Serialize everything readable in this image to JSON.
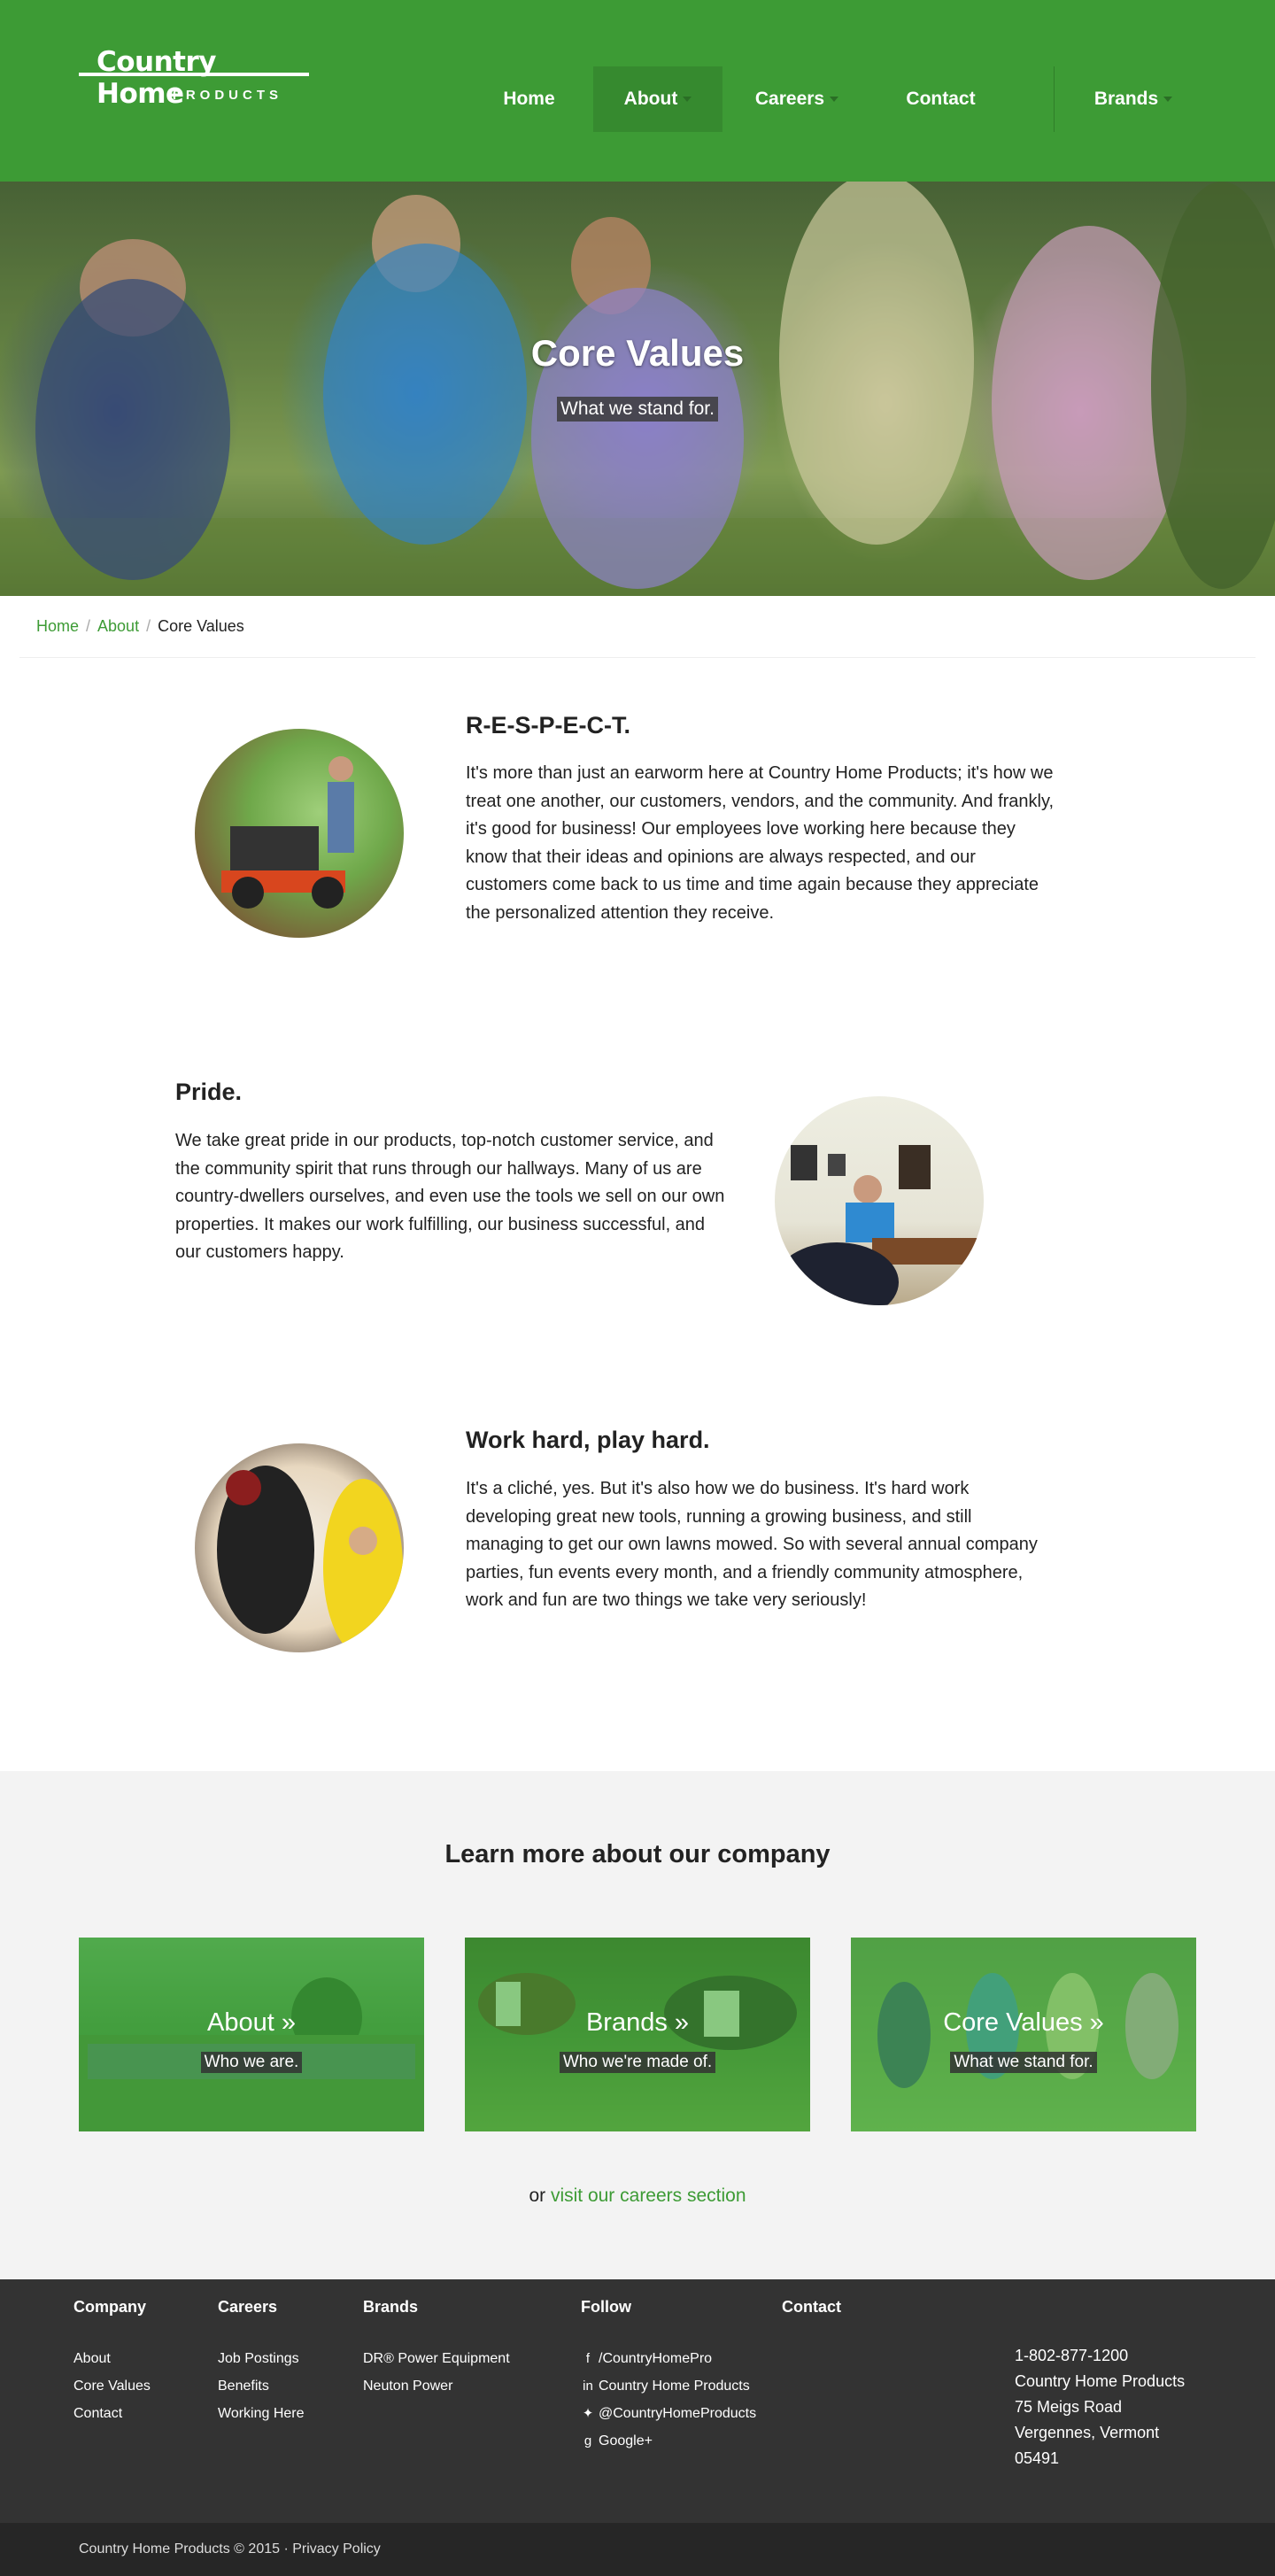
{
  "brand": {
    "name": "Country Home",
    "sub": "PRODUCTS"
  },
  "nav": [
    {
      "label": "Home"
    },
    {
      "label": "About"
    },
    {
      "label": "Careers"
    },
    {
      "label": "Contact"
    },
    {
      "label": "Brands"
    }
  ],
  "hero": {
    "title": "Core Values",
    "subtitle": "What we stand for."
  },
  "breadcrumb": {
    "home": "Home",
    "about": "About",
    "current": "Core Values",
    "sep": "/"
  },
  "values": [
    {
      "title": "R-E-S-P-E-C-T.",
      "text": "It's more than just an earworm here at Country Home Products; it's how we treat one another, our customers, vendors, and the community. And frankly, it's good for business! Our employees love working here because they know that their ideas and opinions are always respected, and our customers come back to us time and time again because they appreciate the personalized attention they receive."
    },
    {
      "title": "Pride.",
      "text": "We take great pride in our products, top-notch customer service, and the community spirit that runs through our hallways. Many of us are country-dwellers ourselves, and even use the tools we sell on our own properties. It makes our work fulfilling, our business successful, and our customers happy."
    },
    {
      "title": "Work hard, play hard.",
      "text": "It's a cliché, yes. But it's also how we do business. It's hard work developing great new tools, running a growing business, and still managing to get our own lawns mowed. So with several annual company parties, fun events every month, and a friendly community atmosphere, work and fun are two things we take very seriously!"
    }
  ],
  "learn": {
    "title_bold": "Learn more",
    "title_rest": " about our company",
    "cards": [
      {
        "title": "About »",
        "sub": "Who we are."
      },
      {
        "title": "Brands »",
        "sub": "Who we're made of."
      },
      {
        "title": "Core Values »",
        "sub": "What we stand for."
      }
    ],
    "careers_prefix": "or ",
    "careers_link": "visit our careers section"
  },
  "footer": {
    "company": {
      "head": "Company",
      "items": [
        "About",
        "Core Values",
        "Contact"
      ]
    },
    "careers": {
      "head": "Careers",
      "items": [
        "Job Postings",
        "Benefits",
        "Working Here"
      ]
    },
    "brands": {
      "head": "Brands",
      "items": [
        "DR® Power Equipment",
        "Neuton Power"
      ]
    },
    "follow": {
      "head": "Follow",
      "items": [
        "/CountryHomePro",
        "Country Home Products",
        "@CountryHomeProducts",
        "Google+"
      ]
    },
    "contact": {
      "head": "Contact",
      "phone": "1-802-877-1200",
      "name": "Country Home Products",
      "street": "75 Meigs Road",
      "city": "Vergennes, Vermont",
      "zip": "05491"
    },
    "copyright": "Country Home Products © 2015 · Privacy Policy"
  },
  "colors": {
    "brand_green": "#3d9b35",
    "active_nav": "#368a2f",
    "footer_bg": "#333333"
  },
  "icons": [
    "facebook-icon",
    "linkedin-icon",
    "twitter-icon",
    "google-plus-icon"
  ]
}
